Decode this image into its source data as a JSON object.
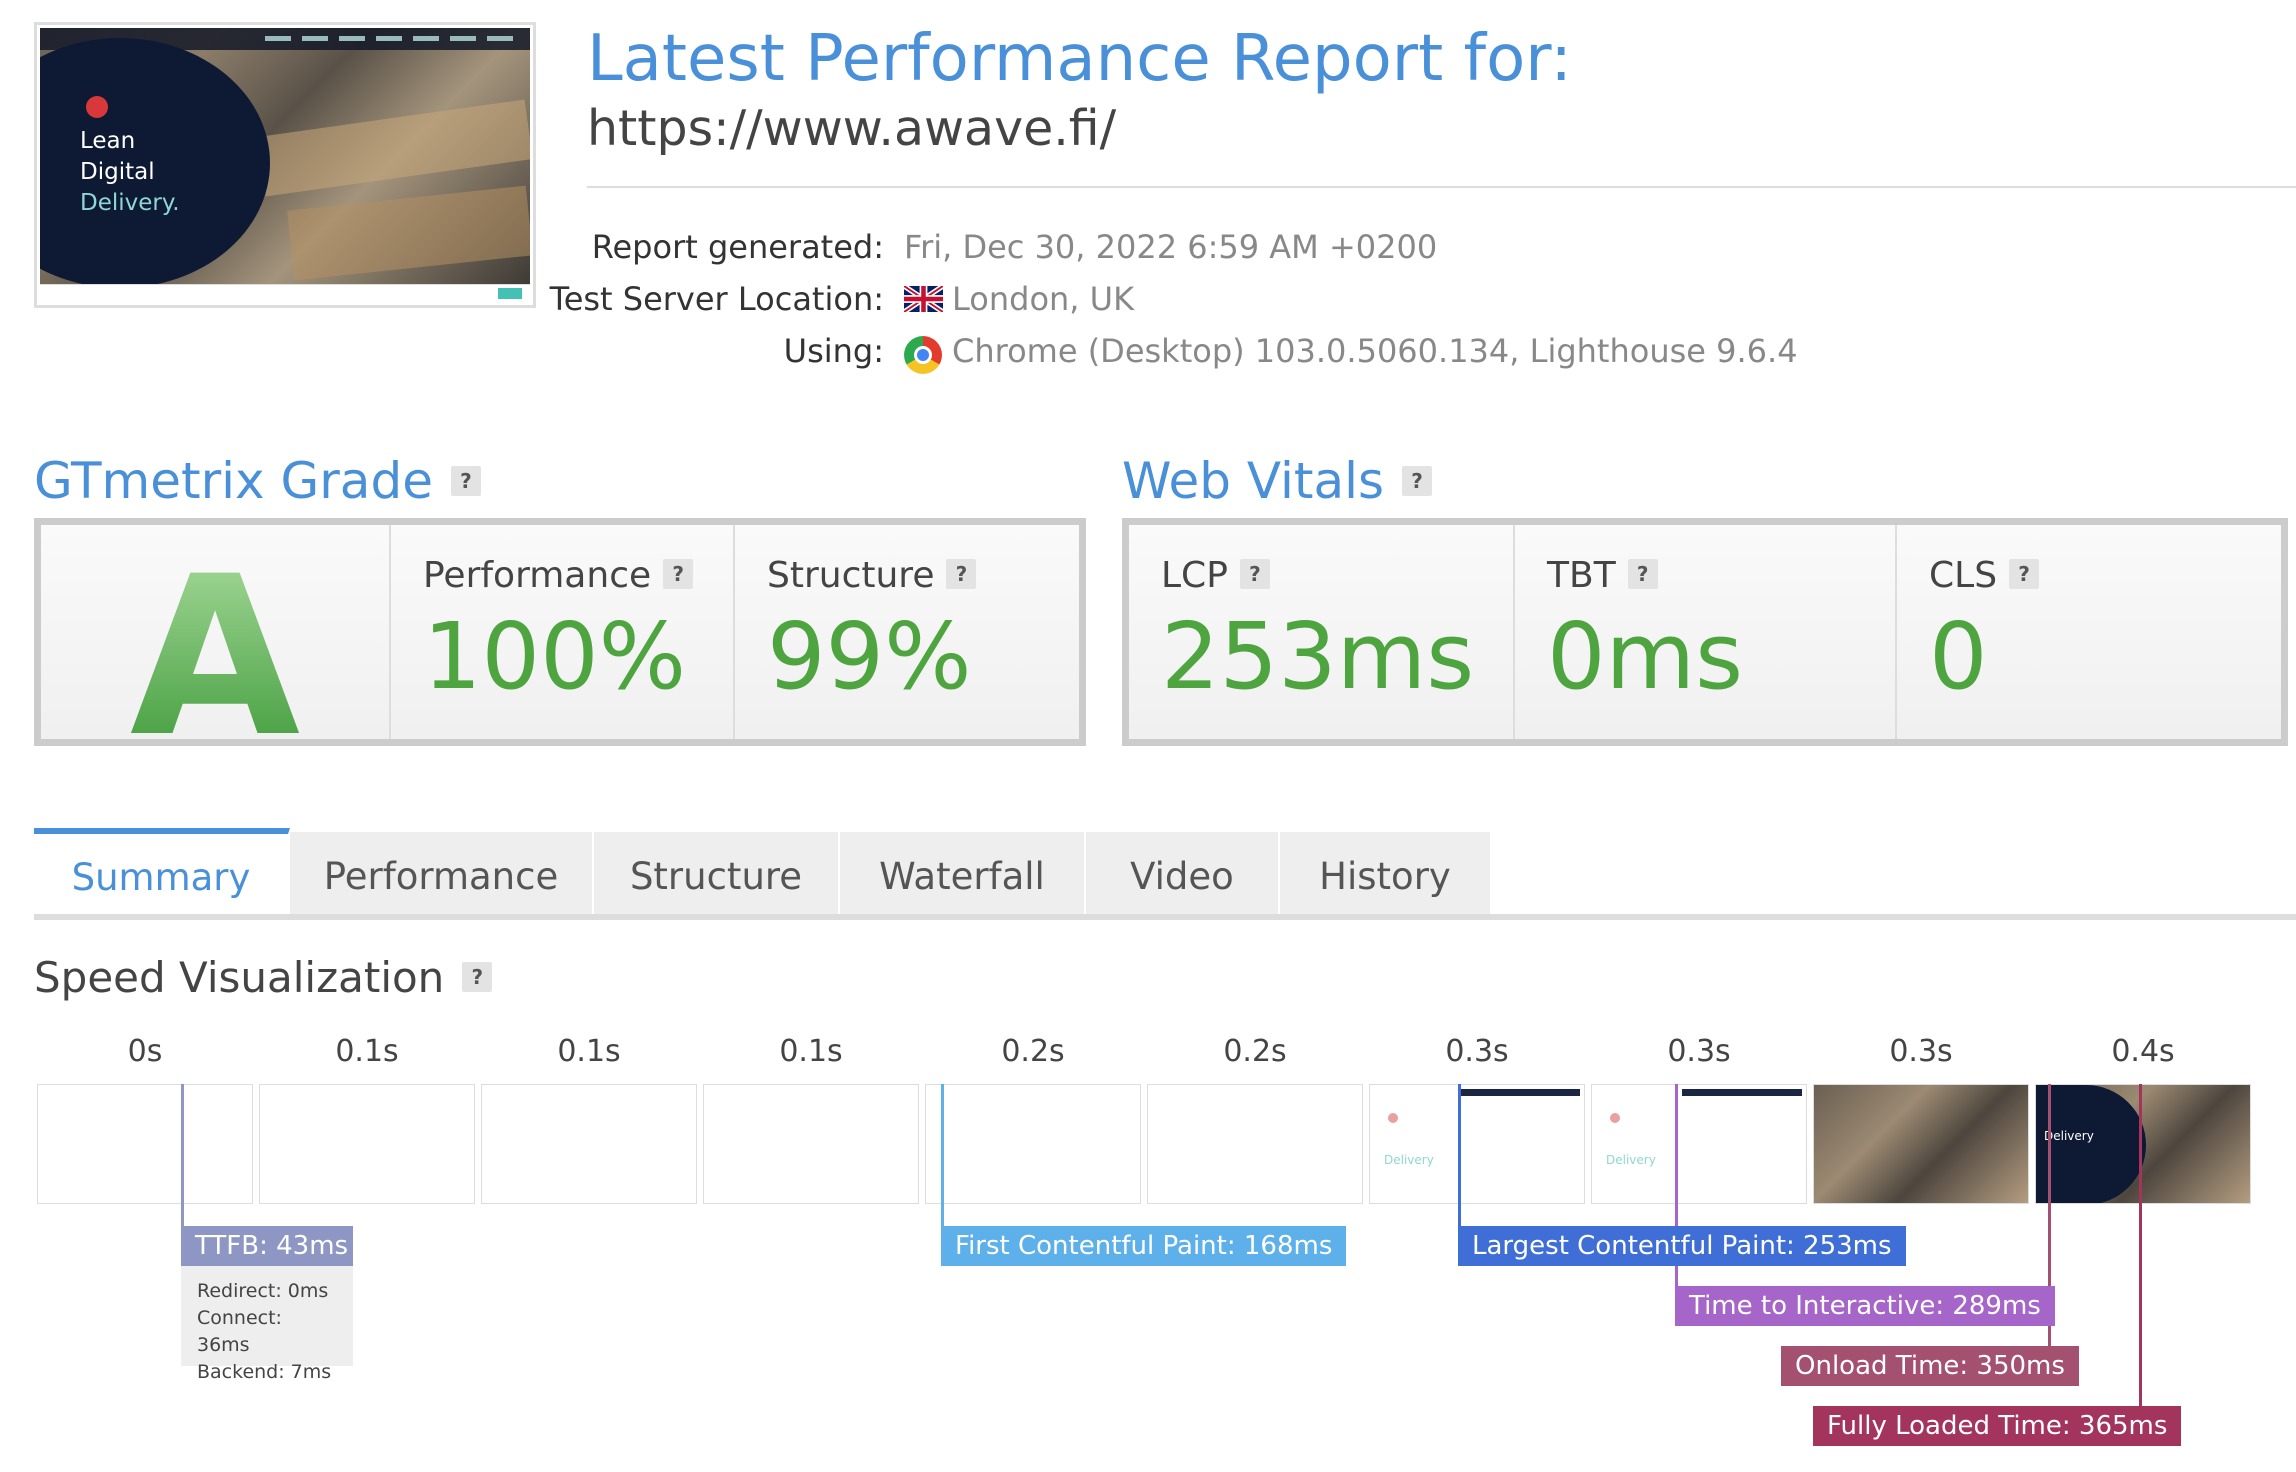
{
  "report": {
    "title": "Latest Performance Report for:",
    "url": "https://www.awave.fi/",
    "generated_label": "Report generated:",
    "generated_value": "Fri, Dec 30, 2022 6:59 AM +0200",
    "location_label": "Test Server Location:",
    "location_value": "London, UK",
    "using_label": "Using:",
    "using_value": "Chrome (Desktop) 103.0.5060.134, Lighthouse 9.6.4"
  },
  "thumbnail": {
    "hero_line1": "Lean",
    "hero_line2": "Digital",
    "hero_line3": "Delivery."
  },
  "grade": {
    "title": "GTmetrix Grade",
    "help": "?",
    "letter": "A",
    "performance_label": "Performance",
    "performance_value": "100%",
    "structure_label": "Structure",
    "structure_value": "99%"
  },
  "vitals": {
    "title": "Web Vitals",
    "help": "?",
    "lcp_label": "LCP",
    "lcp_value": "253ms",
    "tbt_label": "TBT",
    "tbt_value": "0ms",
    "cls_label": "CLS",
    "cls_value": "0"
  },
  "tabs": [
    "Summary",
    "Performance",
    "Structure",
    "Waterfall",
    "Video",
    "History"
  ],
  "speed": {
    "title": "Speed Visualization",
    "help": "?",
    "ticks": [
      "0s",
      "0.1s",
      "0.1s",
      "0.1s",
      "0.2s",
      "0.2s",
      "0.3s",
      "0.3s",
      "0.3s",
      "0.4s"
    ],
    "frame_text": "Delivery",
    "markers": {
      "ttfb": "TTFB: 43ms",
      "fcp": "First Contentful Paint: 168ms",
      "lcp": "Largest Contentful Paint: 253ms",
      "tti": "Time to Interactive: 289ms",
      "onload": "Onload Time: 350ms",
      "fully": "Fully Loaded Time: 365ms"
    },
    "ttfb_detail": {
      "redirect": "Redirect: 0ms",
      "connect": "Connect: 36ms",
      "backend": "Backend: 7ms"
    }
  },
  "colors": {
    "accent": "#4a90d9",
    "good": "#4ea53f",
    "ttfb": "#8e97c4",
    "fcp": "#5db0ea",
    "lcp": "#3f6fd6",
    "tti": "#a565c9",
    "onload": "#a4506f",
    "fully": "#a3345c"
  }
}
